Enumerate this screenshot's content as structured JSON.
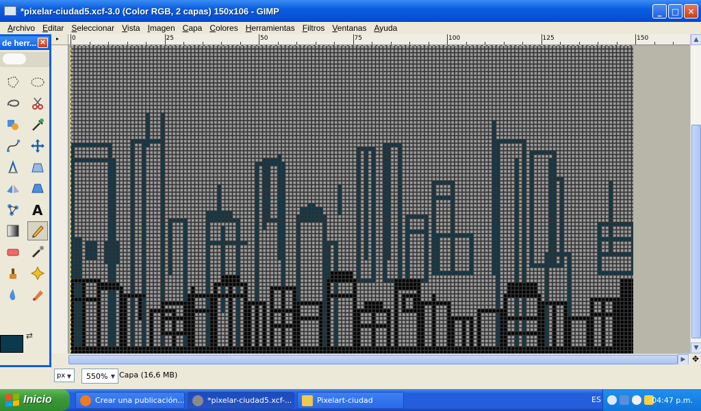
{
  "window": {
    "title": "*pixelar-ciudad5.xcf-3.0 (Color RGB, 2 capas) 150x106 - GIMP",
    "controls": {
      "minimize": "_",
      "maximize": "□",
      "close": "✕"
    }
  },
  "menubar": {
    "items": [
      {
        "label": "Archivo",
        "mnemonic": "A",
        "rest": "rchivo"
      },
      {
        "label": "Editar",
        "mnemonic": "E",
        "rest": "ditar"
      },
      {
        "label": "Seleccionar",
        "mnemonic": "S",
        "rest": "eleccionar"
      },
      {
        "label": "Vista",
        "mnemonic": "V",
        "rest": "ista"
      },
      {
        "label": "Imagen",
        "mnemonic": "I",
        "rest": "magen"
      },
      {
        "label": "Capa",
        "mnemonic": "C",
        "rest": "apa"
      },
      {
        "label": "Colores",
        "mnemonic": "C",
        "rest": "olores"
      },
      {
        "label": "Herramientas",
        "mnemonic": "H",
        "rest": "erramientas"
      },
      {
        "label": "Filtros",
        "mnemonic": "F",
        "rest": "iltros"
      },
      {
        "label": "Ventanas",
        "mnemonic": "V",
        "rest": "entanas"
      },
      {
        "label": "Ayuda",
        "mnemonic": "A",
        "rest": "yuda"
      }
    ]
  },
  "toolbox": {
    "title": "de herr...",
    "tools": [
      {
        "name": "free-select-icon"
      },
      {
        "name": "ellipse-select-icon"
      },
      {
        "name": "lasso-icon"
      },
      {
        "name": "scissors-icon"
      },
      {
        "name": "foreground-select-icon"
      },
      {
        "name": "color-picker-icon"
      },
      {
        "name": "paths-icon"
      },
      {
        "name": "move-icon"
      },
      {
        "name": "shear-icon"
      },
      {
        "name": "perspective-icon"
      },
      {
        "name": "flip-icon"
      },
      {
        "name": "cage-transform-icon"
      },
      {
        "name": "text-icon"
      },
      {
        "name": "text-tool-icon"
      },
      {
        "name": "gradient-icon"
      },
      {
        "name": "pencil-icon"
      },
      {
        "name": "eraser-icon"
      },
      {
        "name": "airbrush-icon"
      },
      {
        "name": "clone-icon"
      },
      {
        "name": "heal-icon"
      },
      {
        "name": "blur-icon"
      },
      {
        "name": "smudge-icon"
      }
    ],
    "active_tool": "pencil-icon",
    "foreground_color": "#0b3a4e",
    "background_color": "#ffffff"
  },
  "ruler": {
    "top_labels": [
      {
        "text": "0"
      },
      {
        "text": "25"
      },
      {
        "text": "50"
      },
      {
        "text": "75"
      },
      {
        "text": "100"
      },
      {
        "text": "125"
      },
      {
        "text": "150"
      }
    ]
  },
  "canvas": {
    "image_width": 150,
    "image_height": 106,
    "zoom_percent": 550
  },
  "statusbar": {
    "unit": "px",
    "zoom": "550%",
    "message": "Capa (16,6 MB)"
  },
  "taskbar": {
    "start_label": "Inicio",
    "tasks": [
      {
        "label": "Crear una publicación...",
        "icon": "firefox-icon",
        "active": false
      },
      {
        "label": "*pixelar-ciudad5.xcf-...",
        "icon": "gimp-icon",
        "active": true
      },
      {
        "label": "Pixelart-ciudad",
        "icon": "folder-icon",
        "active": false
      }
    ],
    "language": "ES",
    "clock": "04:47 p.m."
  },
  "colors": {
    "titlebar": "#0a5ee0",
    "canvas_cell_light": "#9a9a9a",
    "canvas_cell_dark": "#0b3a4e",
    "canvas_ink": "#000000",
    "canvas_grid": "#333333"
  }
}
